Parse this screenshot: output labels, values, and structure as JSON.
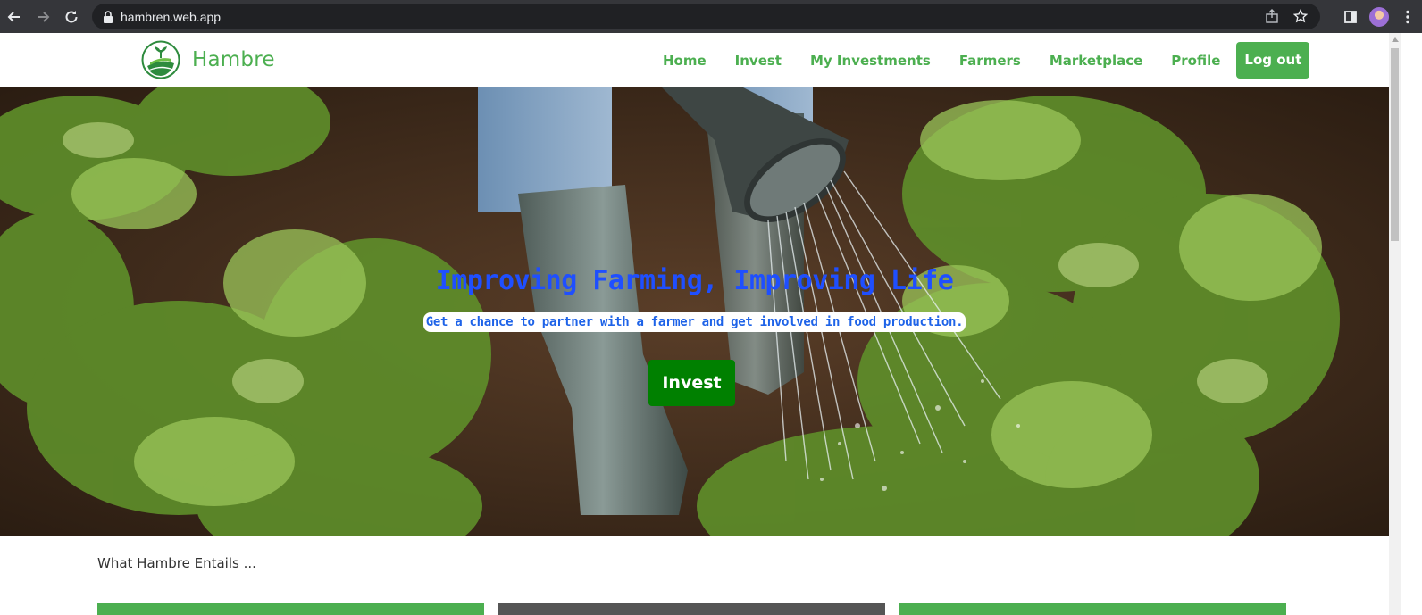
{
  "browser": {
    "url": "hambren.web.app"
  },
  "nav": {
    "brand": "Hambre",
    "items": [
      {
        "label": "Home"
      },
      {
        "label": "Invest"
      },
      {
        "label": "My Investments"
      },
      {
        "label": "Farmers"
      },
      {
        "label": "Marketplace"
      },
      {
        "label": "Profile"
      }
    ],
    "logout_label": "Log out"
  },
  "hero": {
    "title": "Improving Farming, Improving Life",
    "subtitle": "Get a chance to partner with a farmer and get involved in food production.",
    "cta_label": "Invest"
  },
  "section": {
    "heading": "What Hambre Entails ..."
  },
  "colors": {
    "brand_green": "#4caf50",
    "cta_green": "#008000",
    "hero_title_blue": "#1f4fff"
  },
  "icons": [
    "back-arrow-icon",
    "forward-arrow-icon",
    "reload-icon",
    "lock-icon",
    "share-icon",
    "star-icon",
    "side-panel-icon",
    "profile-avatar",
    "kebab-menu-icon",
    "hambre-logo"
  ]
}
